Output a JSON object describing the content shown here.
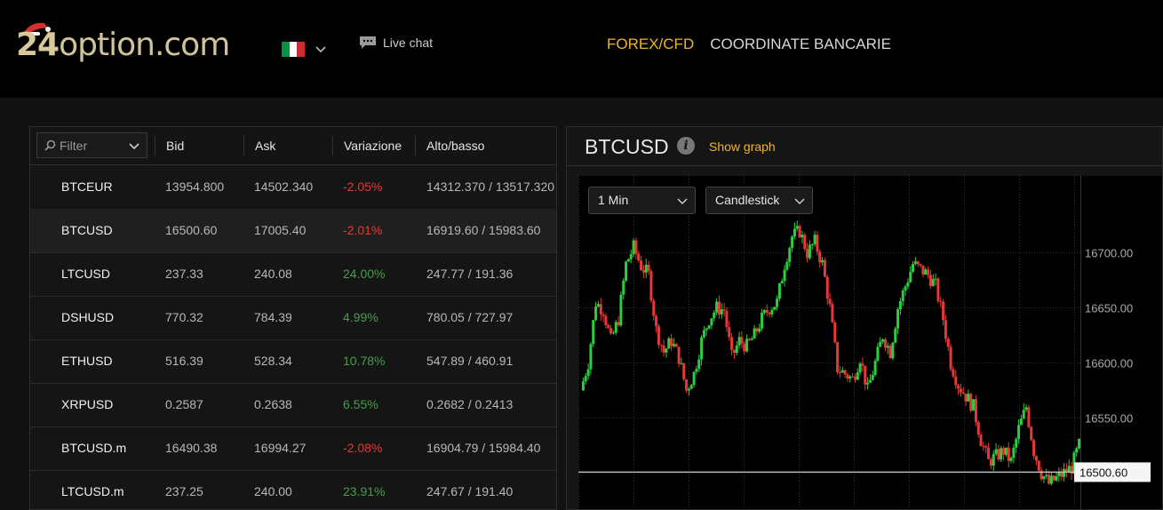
{
  "header": {
    "logo_num": "24",
    "logo_text": "option.com",
    "language": {
      "flag_colors": [
        "#009246",
        "#ffffff",
        "#ce2b37"
      ]
    },
    "livechat_label": "Live chat",
    "nav": [
      {
        "label": "FOREX/CFD",
        "active": true
      },
      {
        "label": "COORDINATE BANCARIE",
        "active": false
      }
    ]
  },
  "table": {
    "filter_placeholder": "Filter",
    "columns": [
      "Bid",
      "Ask",
      "Variazione",
      "Alto/basso"
    ],
    "rows": [
      {
        "symbol": "BTCEUR",
        "bid": "13954.800",
        "ask": "14502.340",
        "change": "-2.05%",
        "dir": "neg",
        "highlow": "14312.370 / 13517.320"
      },
      {
        "symbol": "BTCUSD",
        "bid": "16500.60",
        "ask": "17005.40",
        "change": "-2.01%",
        "dir": "neg",
        "highlow": "16919.60 / 15983.60",
        "selected": true
      },
      {
        "symbol": "LTCUSD",
        "bid": "237.33",
        "ask": "240.08",
        "change": "24.00%",
        "dir": "pos",
        "highlow": "247.77 / 191.36"
      },
      {
        "symbol": "DSHUSD",
        "bid": "770.32",
        "ask": "784.39",
        "change": "4.99%",
        "dir": "pos",
        "highlow": "780.05 / 727.97"
      },
      {
        "symbol": "ETHUSD",
        "bid": "516.39",
        "ask": "528.34",
        "change": "10.78%",
        "dir": "pos",
        "highlow": "547.89 / 460.91"
      },
      {
        "symbol": "XRPUSD",
        "bid": "0.2587",
        "ask": "0.2638",
        "change": "6.55%",
        "dir": "pos",
        "highlow": "0.2682 / 0.2413"
      },
      {
        "symbol": "BTCUSD.m",
        "bid": "16490.38",
        "ask": "16994.27",
        "change": "-2.08%",
        "dir": "neg",
        "highlow": "16904.79 / 15984.40"
      },
      {
        "symbol": "LTCUSD.m",
        "bid": "237.25",
        "ask": "240.00",
        "change": "23.91%",
        "dir": "pos",
        "highlow": "247.67 / 191.40"
      }
    ]
  },
  "chart_panel": {
    "title": "BTCUSD",
    "show_graph_label": "Show graph",
    "interval": "1 Min",
    "chart_type_label": "Candlestick"
  },
  "chart_data": {
    "type": "candlestick",
    "ylim": [
      16467,
      16770
    ],
    "yticks": [
      16550,
      16600,
      16650,
      16700
    ],
    "ytick_labels": [
      "16550.00",
      "16600.00",
      "16650.00",
      "16700.00"
    ],
    "current_price": 16500.6,
    "current_price_label": "16500.60",
    "up_color": "#2ecc40",
    "down_color": "#e53935",
    "close_path": [
      16575,
      16600,
      16655,
      16648,
      16620,
      16640,
      16690,
      16705,
      16688,
      16680,
      16630,
      16610,
      16620,
      16605,
      16575,
      16590,
      16620,
      16640,
      16650,
      16648,
      16605,
      16620,
      16615,
      16625,
      16640,
      16650,
      16655,
      16690,
      16715,
      16720,
      16700,
      16710,
      16690,
      16650,
      16595,
      16590,
      16585,
      16605,
      16575,
      16600,
      16625,
      16610,
      16650,
      16670,
      16690,
      16685,
      16680,
      16670,
      16640,
      16600,
      16580,
      16570,
      16560,
      16530,
      16510,
      16515,
      16520,
      16510,
      16540,
      16560,
      16520,
      16500,
      16490,
      16495,
      16500,
      16505,
      16525
    ],
    "grid": true
  }
}
